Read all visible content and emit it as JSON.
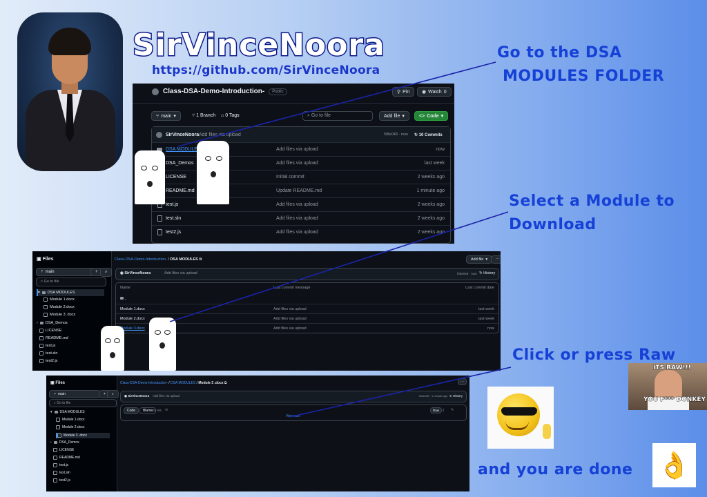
{
  "brand": {
    "name": "SirVinceNoora",
    "url": "https://github.com/SirVinceNoora"
  },
  "captions": {
    "step1_line1": "Go to the DSA",
    "step1_line2": "MODULES FOLDER",
    "step2_line1": "Select a Module to",
    "step2_line2": "Download",
    "step3": "Click or press Raw",
    "step4": "and you are done"
  },
  "repo_page": {
    "repo_name": "Class-DSA-Demo-Introduction-",
    "visibility": "Public",
    "pin_label": "Pin",
    "watch_label": "Watch",
    "watch_count": "0",
    "branch": "main",
    "branch_count": "1 Branch",
    "tag_count": "0 Tags",
    "go_to_file": "Go to file",
    "go_to_file_key": "t",
    "add_file": "Add file",
    "code_button": "Code",
    "commit_author": "SirVinceNoora",
    "commit_message": "Add files via upload",
    "commit_hash": "f38e048 · now",
    "commits_count": "10 Commits",
    "files": [
      {
        "name": "DSA MODULES",
        "message": "Add files via upload",
        "time": "now"
      },
      {
        "name": "DSA_Demos",
        "message": "Add files via upload",
        "time": "last week"
      },
      {
        "name": "LICENSE",
        "message": "Initial commit",
        "time": "2 weeks ago"
      },
      {
        "name": "README.md",
        "message": "Update README.md",
        "time": "1 minute ago"
      },
      {
        "name": "test.js",
        "message": "Add files via upload",
        "time": "2 weeks ago"
      },
      {
        "name": "test.sln",
        "message": "Add files via upload",
        "time": "2 weeks ago"
      },
      {
        "name": "test2.js",
        "message": "Add files via upload",
        "time": "2 weeks ago"
      }
    ]
  },
  "folder_page": {
    "files_label": "Files",
    "branch": "main",
    "go_to_file": "Go to file",
    "breadcrumb_repo": "Class-DSA-Demo-Introduction-",
    "breadcrumb_folder": "DSA MODULES",
    "breadcrumb_sep": "/",
    "add_file": "Add file",
    "commit_author": "SirVinceNoora",
    "commit_message": "Add files via upload",
    "commit_hash": "f38e048 · now",
    "history": "History",
    "col_name": "Name",
    "col_message": "Last commit message",
    "col_date": "Last commit date",
    "parent_dir": "..",
    "files": [
      {
        "name": "Module 1.docx",
        "message": "Add files via upload",
        "time": "last week"
      },
      {
        "name": "Module 2.docx",
        "message": "Add files via upload",
        "time": "last week"
      },
      {
        "name": "Module 3.docx",
        "message": "Add files via upload",
        "time": "now"
      }
    ],
    "tree": [
      "DSA MODULES",
      "Module 1.docx",
      "Module 2.docx",
      "Module 3 .docx",
      "DSA_Demos",
      "LICENSE",
      "README.md",
      "test.js",
      "test.sln",
      "test2.js"
    ]
  },
  "file_page": {
    "files_label": "Files",
    "branch": "main",
    "go_to_file": "Go to file",
    "breadcrumb_repo": "Class-DSA-Demo-Introduction-",
    "breadcrumb_folder": "DSA MODULES",
    "breadcrumb_file": "Module 3 .docx",
    "commit_author": "SirVinceNoora",
    "commit_message": "Add files via upload",
    "commit_hash": "f38e048 · 1 minute ago",
    "history": "History",
    "tab_code": "Code",
    "tab_blame": "Blame",
    "file_size": "221 KB",
    "raw_button": "Raw",
    "view_raw": "View raw",
    "tree": [
      "DSA MODULES",
      "Module 1.docx",
      "Module 2.docx",
      "Module 3 .docx",
      "DSA_Demos",
      "LICENSE",
      "README.md",
      "test.js",
      "test.sln",
      "test2.js"
    ]
  },
  "memes": {
    "ramsay_top": "ITS RAW!!!",
    "ramsay_bottom": "YOU F*** DONKEY"
  },
  "colors": {
    "caption": "#1641d6",
    "brand_stroke": "#0b1a8a",
    "dark_bg": "#0d1117",
    "link": "#4493f8",
    "green": "#238636"
  }
}
